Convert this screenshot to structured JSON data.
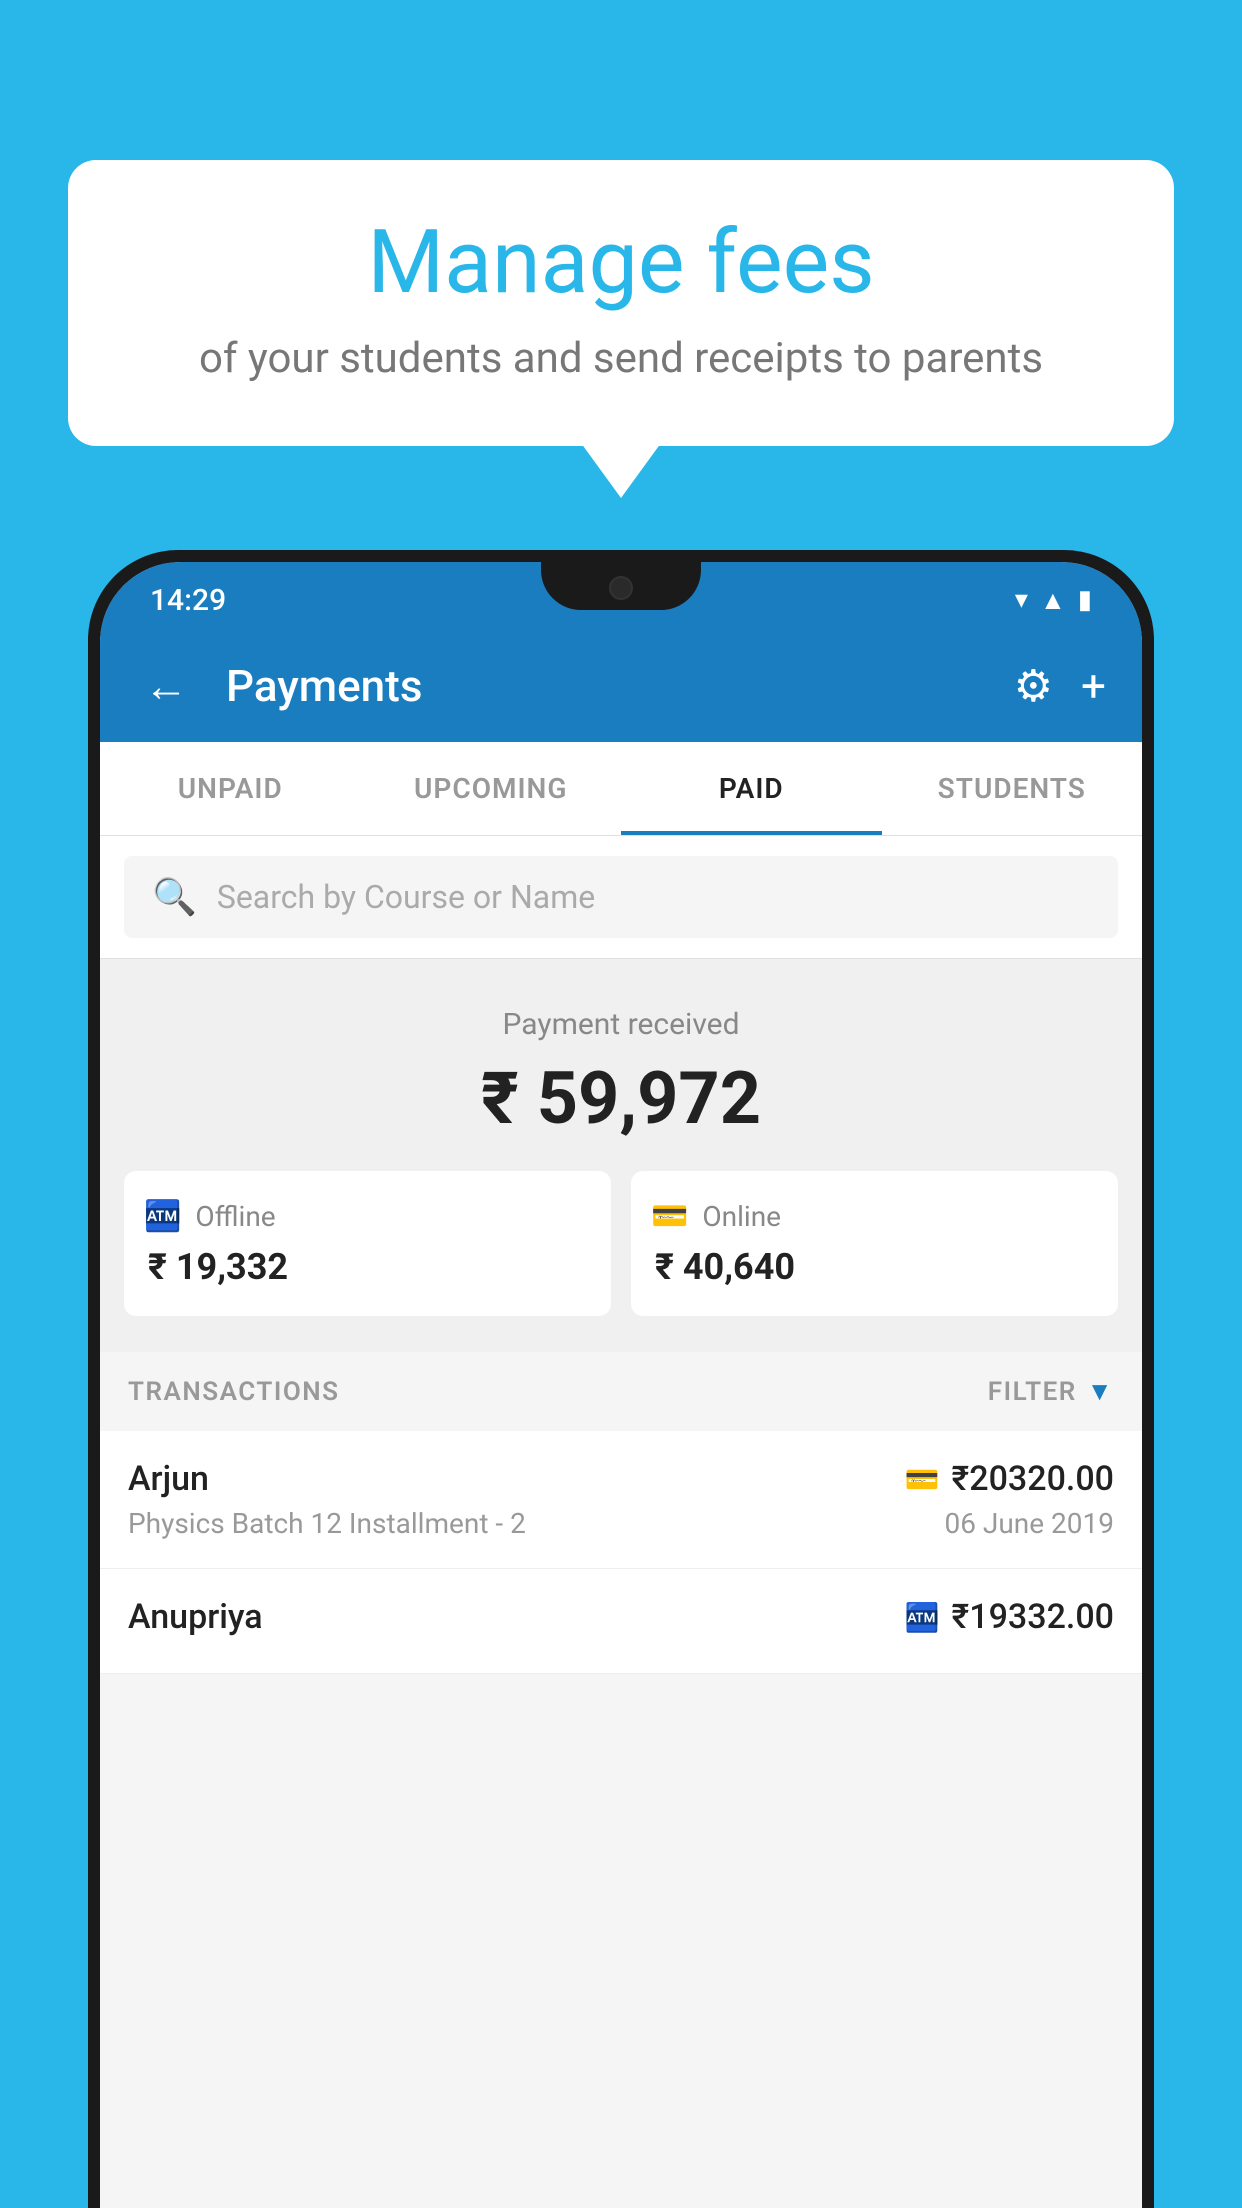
{
  "bubble": {
    "title": "Manage fees",
    "subtitle": "of your students and send receipts to parents"
  },
  "statusBar": {
    "time": "14:29"
  },
  "appBar": {
    "title": "Payments",
    "backLabel": "←",
    "gearLabel": "⚙",
    "addLabel": "+"
  },
  "tabs": [
    {
      "id": "unpaid",
      "label": "UNPAID",
      "active": false
    },
    {
      "id": "upcoming",
      "label": "UPCOMING",
      "active": false
    },
    {
      "id": "paid",
      "label": "PAID",
      "active": true
    },
    {
      "id": "students",
      "label": "STUDENTS",
      "active": false
    }
  ],
  "search": {
    "placeholder": "Search by Course or Name"
  },
  "paymentSummary": {
    "label": "Payment received",
    "total": "₹ 59,972",
    "offline": {
      "type": "Offline",
      "amount": "₹ 19,332"
    },
    "online": {
      "type": "Online",
      "amount": "₹ 40,640"
    }
  },
  "transactions": {
    "header": "TRANSACTIONS",
    "filter": "FILTER",
    "items": [
      {
        "name": "Arjun",
        "course": "Physics Batch 12 Installment - 2",
        "amount": "₹20320.00",
        "date": "06 June 2019",
        "paymentMode": "card"
      },
      {
        "name": "Anupriya",
        "course": "",
        "amount": "₹19332.00",
        "date": "",
        "paymentMode": "cash"
      }
    ]
  },
  "colors": {
    "primary": "#1a7dc0",
    "background": "#29B6E8",
    "white": "#ffffff"
  }
}
